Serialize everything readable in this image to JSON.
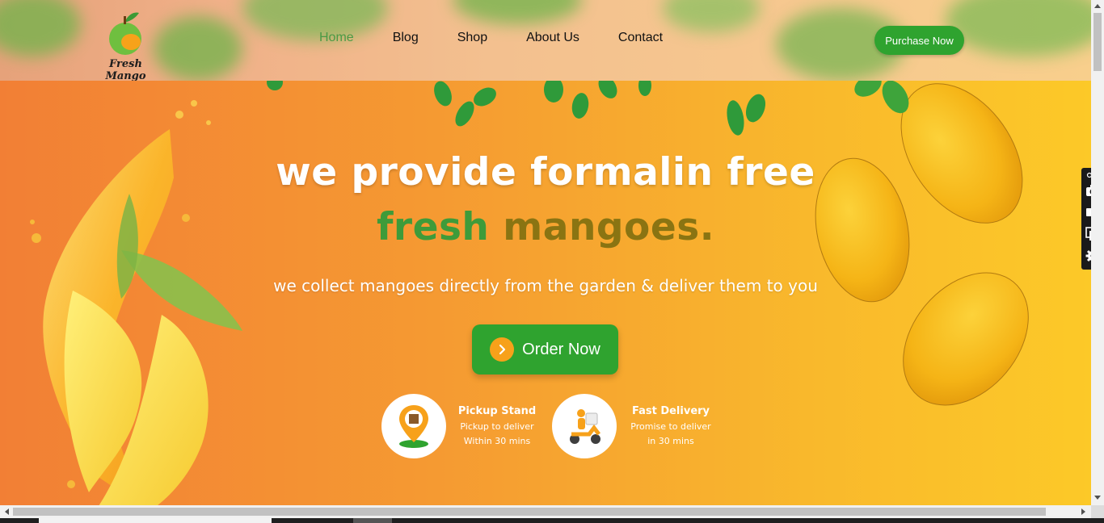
{
  "header": {
    "logo_text": "Fresh Mango",
    "nav": [
      "Home",
      "Blog",
      "Shop",
      "About Us",
      "Contact"
    ],
    "active_nav": "Home",
    "purchase_label": "Purchase Now"
  },
  "hero": {
    "title_line1": "we provide formalin free",
    "title_line2_word1": "fresh",
    "title_line2_word2": "mangoes.",
    "subtitle": "we collect mangoes directly from the garden & deliver them to you",
    "order_label": "Order Now"
  },
  "features": [
    {
      "title": "Pickup Stand",
      "line1": "Pickup to deliver",
      "line2": "Within 30 mins",
      "icon": "location-pin-icon"
    },
    {
      "title": "Fast Delivery",
      "line1": "Promise to deliver",
      "line2": "in 30 mins",
      "icon": "delivery-scooter-icon"
    }
  ],
  "colors": {
    "accent_green": "#2fa32f",
    "title_green": "#3e9b3a",
    "title_olive": "#8a7412",
    "bg_orange": "#f27f35",
    "bg_yellow": "#fcc928"
  },
  "side_toolbar": [
    "camera-icon",
    "video-icon",
    "copy-icon",
    "gear-icon"
  ]
}
